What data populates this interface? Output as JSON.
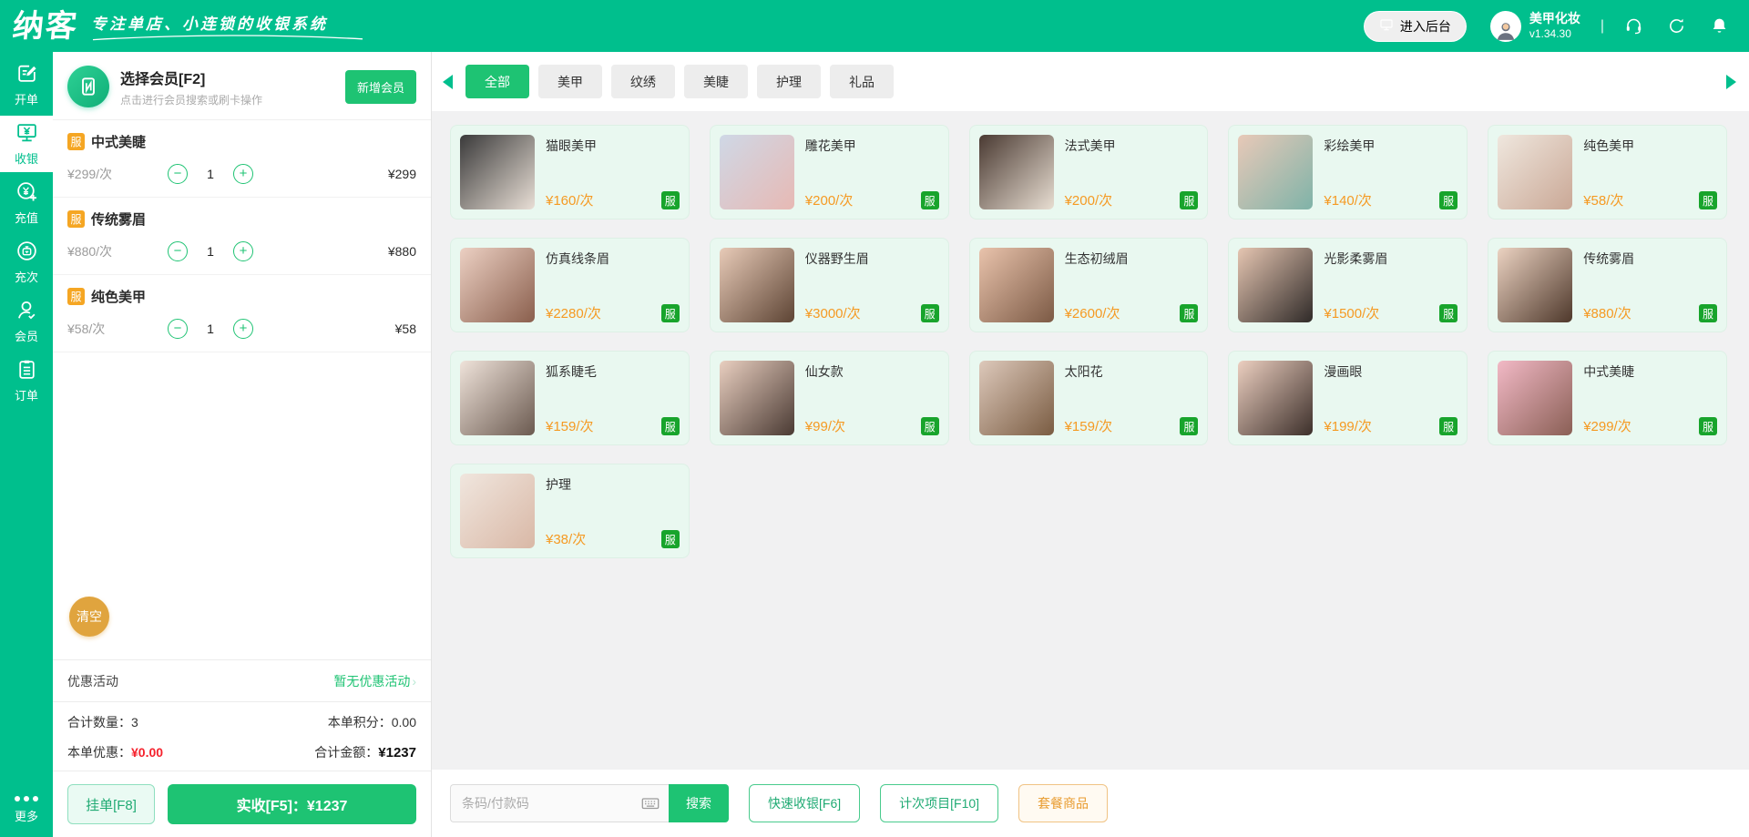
{
  "colors": {
    "brand_green": "#00bf8d",
    "action_green": "#1ec373",
    "badge_green": "#18a42c",
    "badge_orange": "#f5a623",
    "price_orange": "#f59a23",
    "clear_orange": "#e0a43e",
    "discount_red": "#f5222d",
    "card_bg": "#e9f8f0"
  },
  "header": {
    "logo": "纳客",
    "slogan": "专注单店、小连锁的收银系统",
    "backstage_button": "进入后台",
    "account_name": "美甲化妆",
    "version": "v1.34.30",
    "divider": "|"
  },
  "sidebar": {
    "items": [
      {
        "label": "开单",
        "icon": "order-edit-icon",
        "active": false
      },
      {
        "label": "收银",
        "icon": "cashier-icon",
        "active": true
      },
      {
        "label": "充值",
        "icon": "recharge-icon",
        "active": false
      },
      {
        "label": "充次",
        "icon": "recharge-times-icon",
        "active": false
      },
      {
        "label": "会员",
        "icon": "member-icon",
        "active": false
      },
      {
        "label": "订单",
        "icon": "orders-icon",
        "active": false
      }
    ],
    "more_label": "更多"
  },
  "member_panel": {
    "select_title": "选择会员[F2]",
    "select_hint": "点击进行会员搜索或刷卡操作",
    "add_member_button": "新增会员",
    "cart": [
      {
        "badge": "服",
        "name": "中式美睫",
        "unit_price": "¥299/次",
        "qty": "1",
        "amount": "¥299"
      },
      {
        "badge": "服",
        "name": "传统雾眉",
        "unit_price": "¥880/次",
        "qty": "1",
        "amount": "¥880"
      },
      {
        "badge": "服",
        "name": "纯色美甲",
        "unit_price": "¥58/次",
        "qty": "1",
        "amount": "¥58"
      }
    ],
    "clear_button": "清空",
    "promo_label": "优惠活动",
    "promo_value": "暂无优惠活动",
    "promo_chevron": "›",
    "totals": {
      "qty_label": "合计数量：",
      "qty": "3",
      "points_label": "本单积分：",
      "points": "0.00",
      "discount_label": "本单优惠：",
      "discount": "¥0.00",
      "amount_label": "合计金额：",
      "amount": "¥1237"
    },
    "hold_button": "挂单[F8]",
    "pay_button": "实收[F5]：¥1237"
  },
  "catalog": {
    "tabs": [
      {
        "label": "全部",
        "active": true
      },
      {
        "label": "美甲",
        "active": false
      },
      {
        "label": "纹绣",
        "active": false
      },
      {
        "label": "美睫",
        "active": false
      },
      {
        "label": "护理",
        "active": false
      },
      {
        "label": "礼品",
        "active": false
      }
    ],
    "products": [
      {
        "name": "猫眼美甲",
        "price": "¥160/次",
        "badge": "服",
        "img": [
          "#3a3a3a",
          "#e9dfd6"
        ]
      },
      {
        "name": "雕花美甲",
        "price": "¥200/次",
        "badge": "服",
        "img": [
          "#cfd8e6",
          "#e7b9b4"
        ]
      },
      {
        "name": "法式美甲",
        "price": "¥200/次",
        "badge": "服",
        "img": [
          "#4a3a32",
          "#e8ded2"
        ]
      },
      {
        "name": "彩绘美甲",
        "price": "¥140/次",
        "badge": "服",
        "img": [
          "#e8c9b8",
          "#7fb3a8"
        ]
      },
      {
        "name": "纯色美甲",
        "price": "¥58/次",
        "badge": "服",
        "img": [
          "#efe7de",
          "#caa896"
        ]
      },
      {
        "name": "仿真线条眉",
        "price": "¥2280/次",
        "badge": "服",
        "img": [
          "#ecd0c3",
          "#8a5f4d"
        ]
      },
      {
        "name": "仪器野生眉",
        "price": "¥3000/次",
        "badge": "服",
        "img": [
          "#e8cbb8",
          "#5d4434"
        ]
      },
      {
        "name": "生态初绒眉",
        "price": "¥2600/次",
        "badge": "服",
        "img": [
          "#e9c3ac",
          "#7c5a45"
        ]
      },
      {
        "name": "光影柔雾眉",
        "price": "¥1500/次",
        "badge": "服",
        "img": [
          "#e6c6b2",
          "#2f2a28"
        ]
      },
      {
        "name": "传统雾眉",
        "price": "¥880/次",
        "badge": "服",
        "img": [
          "#ecd3c2",
          "#4e382b"
        ]
      },
      {
        "name": "狐系睫毛",
        "price": "¥159/次",
        "badge": "服",
        "img": [
          "#efe3da",
          "#6b5a50"
        ]
      },
      {
        "name": "仙女款",
        "price": "¥99/次",
        "badge": "服",
        "img": [
          "#e9cfc0",
          "#4a3a33"
        ]
      },
      {
        "name": "太阳花",
        "price": "¥159/次",
        "badge": "服",
        "img": [
          "#ddc9bb",
          "#7a5c42"
        ]
      },
      {
        "name": "漫画眼",
        "price": "¥199/次",
        "badge": "服",
        "img": [
          "#eccfc0",
          "#3c2f2a"
        ]
      },
      {
        "name": "中式美睫",
        "price": "¥299/次",
        "badge": "服",
        "img": [
          "#f2b9c6",
          "#8a5f55"
        ]
      },
      {
        "name": "护理",
        "price": "¥38/次",
        "badge": "服",
        "img": [
          "#f0e6de",
          "#d9b8a6"
        ]
      }
    ]
  },
  "bottom_bar": {
    "search_placeholder": "条码/付款码",
    "search_button": "搜索",
    "quick_cashier_button": "快速收银[F6]",
    "count_item_button": "计次项目[F10]",
    "package_button": "套餐商品"
  }
}
